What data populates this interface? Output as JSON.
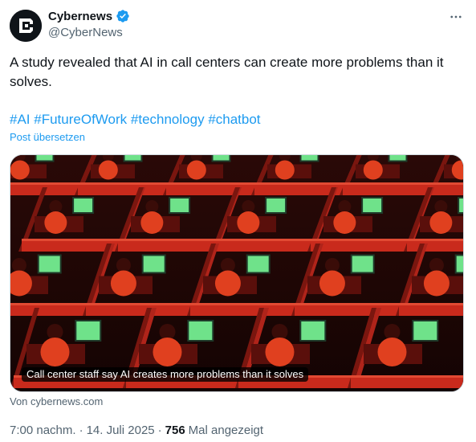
{
  "author": {
    "display_name": "Cybernews",
    "handle": "@CyberNews",
    "avatar_icon": "cybernews-logo",
    "verified_icon": "verified-badge-icon",
    "verified_color": "#1d9bf0"
  },
  "menu_icon": "more-options-icon",
  "tweet": {
    "text": "A study revealed that AI in call centers can create more problems than it solves.",
    "hashtags": [
      "#AI",
      "#FutureOfWork",
      "#technology",
      "#chatbot"
    ],
    "translate_label": "Post übersetzen"
  },
  "media": {
    "caption": "Call center staff say AI creates more problems than it solves",
    "source": "Von cybernews.com"
  },
  "meta": {
    "time": "7:00 nachm.",
    "separator": "·",
    "date": "14. Juli 2025",
    "views_count": "756",
    "views_label": "Mal angezeigt"
  },
  "colors": {
    "link": "#1d9bf0",
    "secondary_text": "#536471",
    "primary_text": "#0f1419"
  }
}
